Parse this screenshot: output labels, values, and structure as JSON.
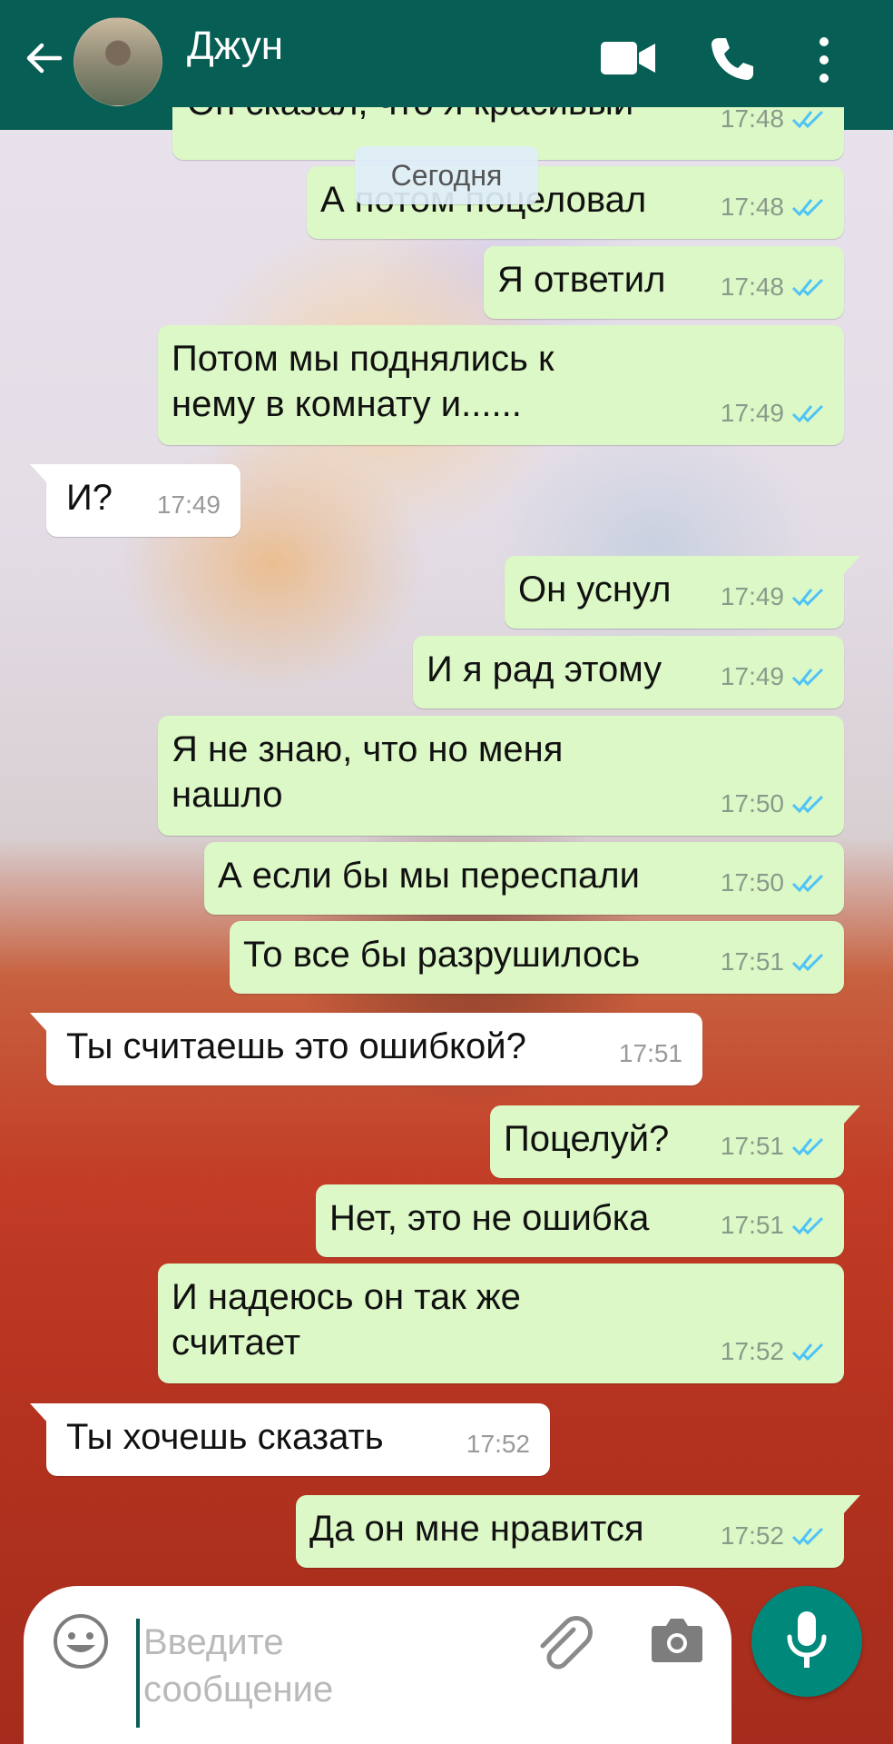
{
  "header": {
    "contact_name": "Джун",
    "back_icon": "arrow-left-icon",
    "video_icon": "video-call-icon",
    "call_icon": "phone-icon",
    "menu_icon": "more-vert-icon",
    "background_color": "#075e54"
  },
  "date_chip": "Сегодня",
  "messages": [
    {
      "dir": "out",
      "text": "Он сказал, что я красивый",
      "time": "17:48"
    },
    {
      "dir": "out",
      "text": "А потом поцеловал",
      "time": "17:48"
    },
    {
      "dir": "out",
      "text": "Я ответил",
      "time": "17:48"
    },
    {
      "dir": "out",
      "text": "Потом мы поднялись к\nнему в комнату и......",
      "time": "17:49"
    },
    {
      "dir": "in",
      "text": "И?",
      "time": "17:49"
    },
    {
      "dir": "out",
      "text": "Он уснул",
      "time": "17:49"
    },
    {
      "dir": "out",
      "text": "И я рад этому",
      "time": "17:49"
    },
    {
      "dir": "out",
      "text": "Я не знаю, что но меня\nнашло",
      "time": "17:50"
    },
    {
      "dir": "out",
      "text": "А если бы мы переспали",
      "time": "17:50"
    },
    {
      "dir": "out",
      "text": "То все бы разрушилось",
      "time": "17:51"
    },
    {
      "dir": "in",
      "text": "Ты считаешь это ошибкой?",
      "time": "17:51"
    },
    {
      "dir": "out",
      "text": "Поцелуй?",
      "time": "17:51"
    },
    {
      "dir": "out",
      "text": "Нет, это не ошибка",
      "time": "17:51"
    },
    {
      "dir": "out",
      "text": "И надеюсь он так же\nсчитает",
      "time": "17:52"
    },
    {
      "dir": "in",
      "text": "Ты хочешь сказать",
      "time": "17:52"
    },
    {
      "dir": "out",
      "text": "Да он мне нравится",
      "time": "17:52"
    }
  ],
  "input": {
    "placeholder": "Введите\nсообщение",
    "emoji_icon": "emoji-icon",
    "attach_icon": "paperclip-icon",
    "camera_icon": "camera-icon",
    "mic_icon": "microphone-icon"
  },
  "colors": {
    "outgoing_bubble": "#dcf8c6",
    "incoming_bubble": "#ffffff",
    "read_ticks": "#4fc3f7",
    "mic_button": "#00897b"
  }
}
